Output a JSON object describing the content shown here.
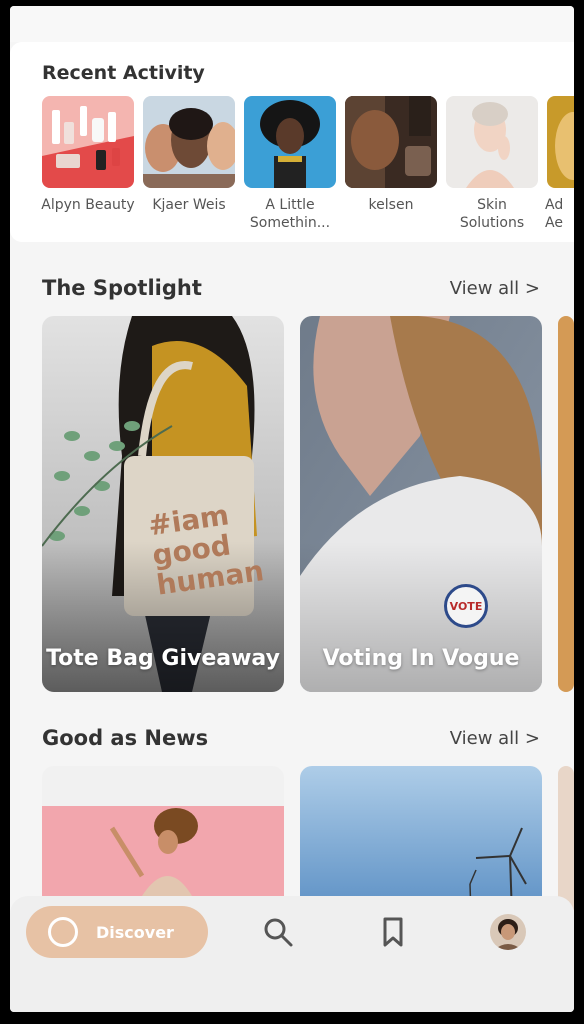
{
  "recent_activity": {
    "title": "Recent Activity",
    "items": [
      {
        "label": "Alpyn Beauty"
      },
      {
        "label": "Kjaer Weis"
      },
      {
        "label": "A Little Somethin..."
      },
      {
        "label": "kelsen"
      },
      {
        "label": "Skin Solutions"
      },
      {
        "label": "Ad Ae"
      }
    ]
  },
  "spotlight": {
    "title": "The Spotlight",
    "view_all": "View all >",
    "cards": [
      {
        "title": "Tote Bag Giveaway",
        "bag_text": "#iam good human"
      },
      {
        "title": "Voting In Vogue",
        "pin_text": "VOTE"
      }
    ]
  },
  "good_news": {
    "title": "Good as News",
    "view_all": "View all >"
  },
  "nav": {
    "discover_label": "Discover",
    "search_icon": "search-icon",
    "bookmark_icon": "bookmark-icon",
    "profile": "profile-avatar"
  },
  "colors": {
    "accent": "#e7c2a5",
    "background": "#f5f5f5"
  }
}
